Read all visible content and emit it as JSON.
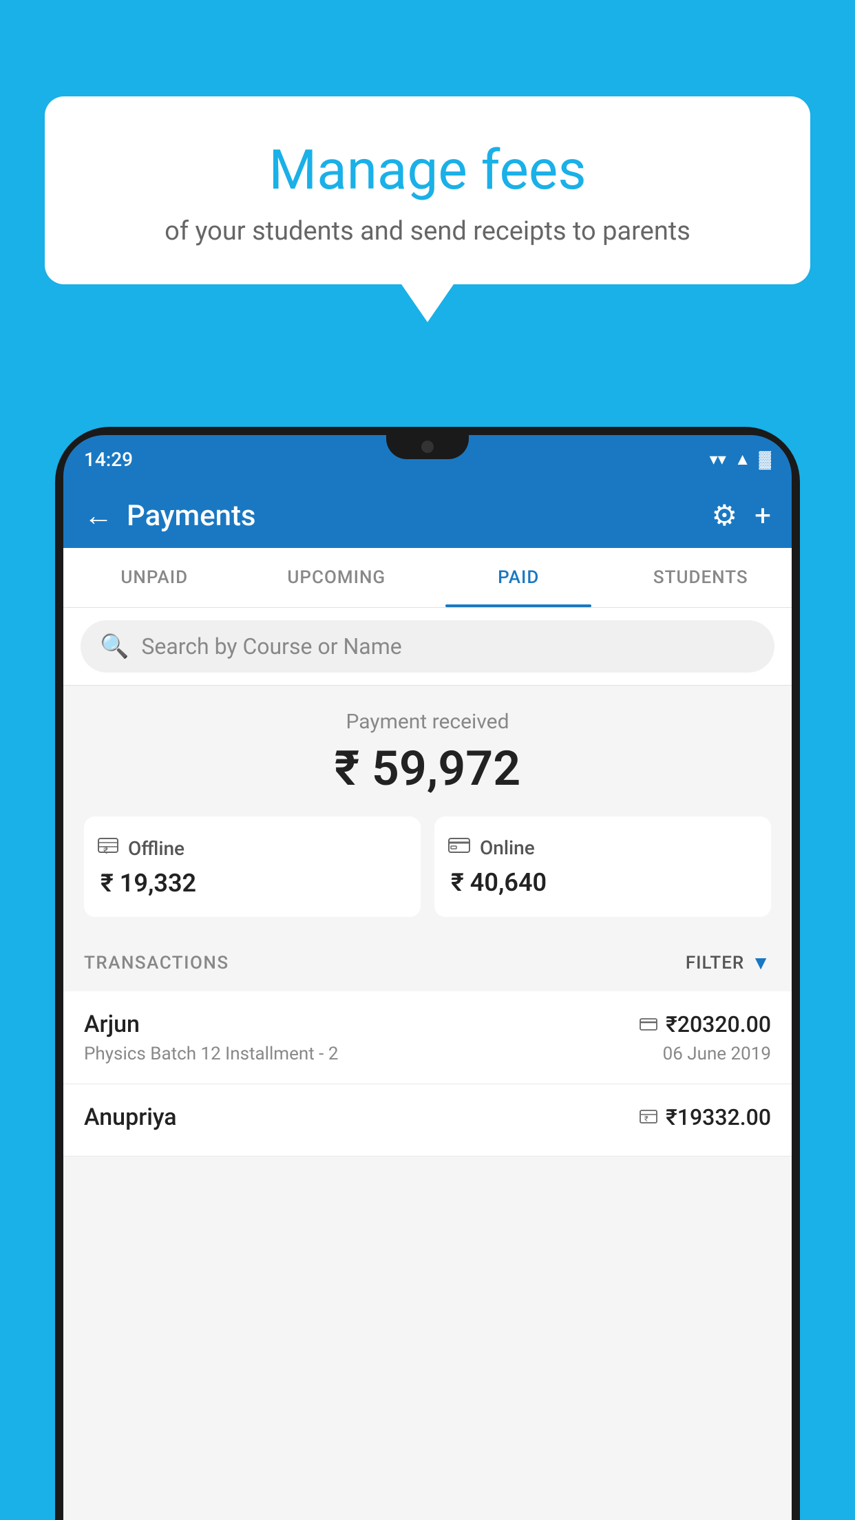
{
  "background_color": "#1ab0e8",
  "speech_bubble": {
    "title": "Manage fees",
    "subtitle": "of your students and send receipts to parents"
  },
  "status_bar": {
    "time": "14:29",
    "wifi": "▼",
    "signal": "▲",
    "battery": "▌"
  },
  "header": {
    "title": "Payments",
    "back_label": "←",
    "gear_label": "⚙",
    "plus_label": "+"
  },
  "tabs": [
    {
      "id": "unpaid",
      "label": "UNPAID",
      "active": false
    },
    {
      "id": "upcoming",
      "label": "UPCOMING",
      "active": false
    },
    {
      "id": "paid",
      "label": "PAID",
      "active": true
    },
    {
      "id": "students",
      "label": "STUDENTS",
      "active": false
    }
  ],
  "search": {
    "placeholder": "Search by Course or Name"
  },
  "payment_summary": {
    "label": "Payment received",
    "total": "₹ 59,972",
    "offline": {
      "label": "Offline",
      "amount": "₹ 19,332"
    },
    "online": {
      "label": "Online",
      "amount": "₹ 40,640"
    }
  },
  "transactions_section": {
    "label": "TRANSACTIONS",
    "filter_label": "FILTER"
  },
  "transactions": [
    {
      "name": "Arjun",
      "course": "Physics Batch 12 Installment - 2",
      "amount": "₹20320.00",
      "date": "06 June 2019",
      "payment_type": "online"
    },
    {
      "name": "Anupriya",
      "course": "",
      "amount": "₹19332.00",
      "date": "",
      "payment_type": "offline"
    }
  ]
}
